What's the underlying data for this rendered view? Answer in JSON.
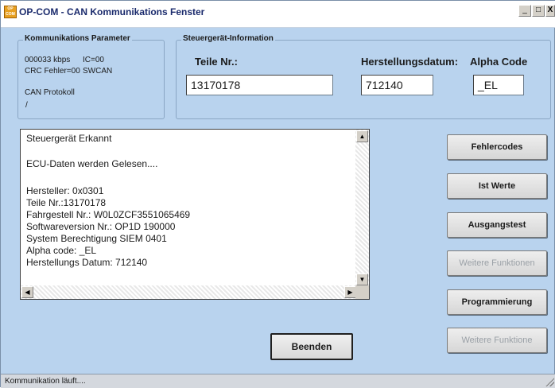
{
  "window": {
    "app_icon_text": "OP COM",
    "title": "OP-COM - CAN Kommunikations Fenster",
    "minimize": "_",
    "maximize": "□",
    "close": "X"
  },
  "kommunikation": {
    "legend": "Kommunikations Parameter",
    "baud": "000033 kbps",
    "ic": "IC=00",
    "crc": "CRC Fehler=00",
    "bus": "SWCAN",
    "protokoll": "CAN Protokoll",
    "protokoll_value": "/"
  },
  "steuergeraet": {
    "legend": "Steuergerät-Information",
    "teile_label": "Teile Nr.:",
    "teile_value": "13170178",
    "datum_label": "Herstellungsdatum:",
    "datum_value": "712140",
    "alpha_label": "Alpha Code",
    "alpha_value": "_EL"
  },
  "log": {
    "lines": [
      "Steuergerät Erkannt",
      "ECU-Daten werden Gelesen....",
      "Hersteller: 0x0301",
      "Teile Nr.:13170178",
      "Fahrgestell Nr.: W0L0ZCF3551065469",
      "Softwareversion Nr.: OP1D 190000",
      "System Berechtigung SIEM 0401",
      "Alpha code: _EL",
      "Herstellungs Datum: 712140"
    ]
  },
  "buttons": {
    "fehlercodes": "Fehlercodes",
    "ist_werte": "Ist Werte",
    "ausgangstest": "Ausgangstest",
    "weitere_funktionen": "Weitere Funktionen",
    "programmierung": "Programmierung",
    "weitere_funktione": "Weitere Funktione",
    "beenden": "Beenden"
  },
  "status": {
    "text": "Kommunikation läuft...."
  }
}
